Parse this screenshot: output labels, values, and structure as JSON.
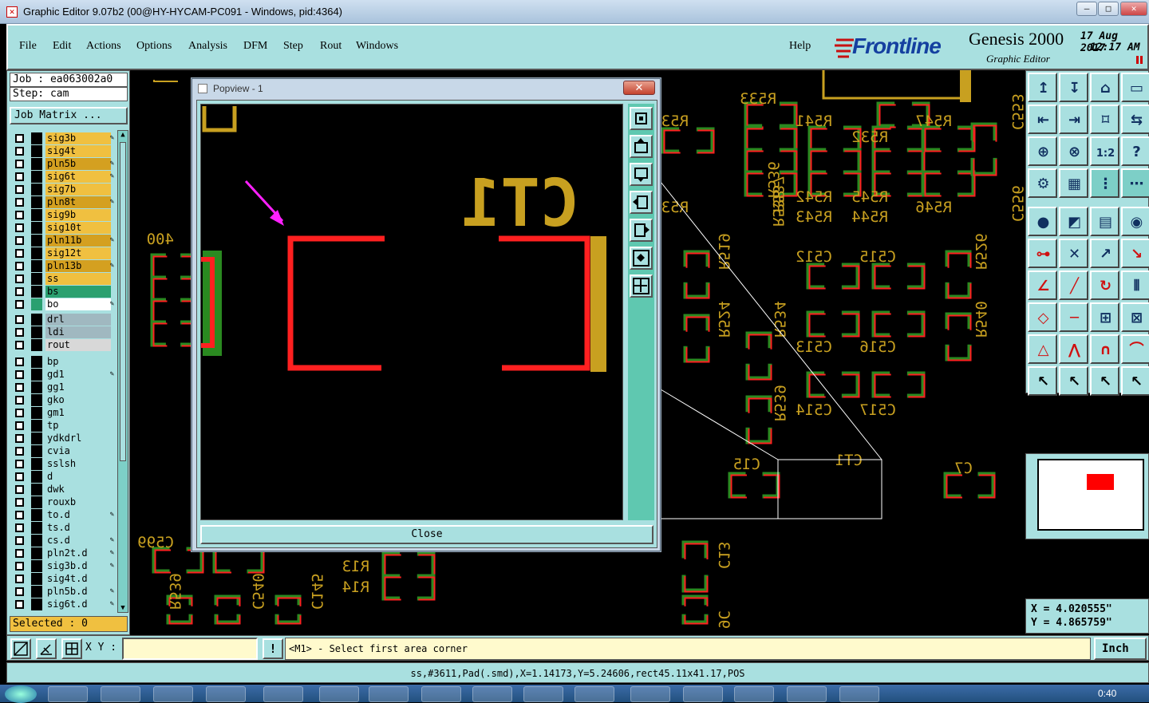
{
  "window": {
    "title": "Graphic Editor 9.07b2 (00@HY-HYCAM-PC091 - Windows, pid:4364)",
    "controls": [
      "—",
      "□",
      "✕"
    ]
  },
  "menu": {
    "items": [
      "File",
      "Edit",
      "Actions",
      "Options",
      "Analysis",
      "DFM",
      "Step",
      "Rout",
      "Windows"
    ],
    "help": "Help"
  },
  "brand": {
    "logo": "Frontline",
    "product": "Genesis 2000",
    "subtitle": "Graphic Editor",
    "date": "17 Aug 2017",
    "time": "12:17 AM"
  },
  "job": {
    "job_label": "Job : ea063002a0",
    "step_label": "Step: cam",
    "matrix_button": "Job Matrix ..."
  },
  "layers": {
    "group1": [
      {
        "name": "sig3b",
        "color": "#f0c040",
        "edit": true
      },
      {
        "name": "sig4t",
        "color": "#f0c040",
        "edit": false
      },
      {
        "name": "pln5b",
        "color": "#d4a020",
        "edit": true
      },
      {
        "name": "sig6t",
        "color": "#f0c040",
        "edit": true
      },
      {
        "name": "sig7b",
        "color": "#f0c040",
        "edit": false
      },
      {
        "name": "pln8t",
        "color": "#d4a020",
        "edit": true
      },
      {
        "name": "sig9b",
        "color": "#f0c040",
        "edit": false
      },
      {
        "name": "sig10t",
        "color": "#f0c040",
        "edit": false
      },
      {
        "name": "pln11b",
        "color": "#d4a020",
        "edit": true
      },
      {
        "name": "sig12t",
        "color": "#f0c040",
        "edit": false
      },
      {
        "name": "pln13b",
        "color": "#d4a020",
        "edit": true
      },
      {
        "name": "ss",
        "color": "#f0c040",
        "edit": false
      },
      {
        "name": "bs",
        "color": "#2aa070",
        "edit": false
      },
      {
        "name": "bo",
        "color": "#ffffff",
        "edit": true
      }
    ],
    "group2": [
      {
        "name": "drl",
        "color": "#a0b8c0",
        "edit": false
      },
      {
        "name": "ldi",
        "color": "#a0b8c0",
        "edit": false
      },
      {
        "name": "rout",
        "color": "#d8d8d8",
        "edit": false
      }
    ],
    "group3": [
      {
        "name": "bp",
        "color": "#a9e0e0",
        "edit": false
      },
      {
        "name": "gd1",
        "color": "#a9e0e0",
        "edit": true
      },
      {
        "name": "gg1",
        "color": "#a9e0e0",
        "edit": false
      },
      {
        "name": "gko",
        "color": "#a9e0e0",
        "edit": false
      },
      {
        "name": "gm1",
        "color": "#a9e0e0",
        "edit": false
      },
      {
        "name": "tp",
        "color": "#a9e0e0",
        "edit": false
      },
      {
        "name": "ydkdrl",
        "color": "#a9e0e0",
        "edit": false
      },
      {
        "name": "cvia",
        "color": "#a9e0e0",
        "edit": false
      },
      {
        "name": "sslsh",
        "color": "#a9e0e0",
        "edit": false
      },
      {
        "name": "d",
        "color": "#a9e0e0",
        "edit": false
      },
      {
        "name": "dwk",
        "color": "#a9e0e0",
        "edit": false
      },
      {
        "name": "rouxb",
        "color": "#a9e0e0",
        "edit": false
      },
      {
        "name": "to.d",
        "color": "#a9e0e0",
        "edit": true
      },
      {
        "name": "ts.d",
        "color": "#a9e0e0",
        "edit": false
      },
      {
        "name": "cs.d",
        "color": "#a9e0e0",
        "edit": true
      },
      {
        "name": "pln2t.d",
        "color": "#a9e0e0",
        "edit": true
      },
      {
        "name": "sig3b.d",
        "color": "#a9e0e0",
        "edit": true
      },
      {
        "name": "sig4t.d",
        "color": "#a9e0e0",
        "edit": false
      },
      {
        "name": "pln5b.d",
        "color": "#a9e0e0",
        "edit": true
      },
      {
        "name": "sig6t.d",
        "color": "#a9e0e0",
        "edit": true
      }
    ],
    "selected_label": "Selected : 0"
  },
  "popview": {
    "title": "Popview - 1",
    "component_label": "CT1",
    "close_label": "Close"
  },
  "pcb": {
    "labels": [
      {
        "t": "R533"
      },
      {
        "t": "R531"
      },
      {
        "t": "R541"
      },
      {
        "t": "R532"
      },
      {
        "t": "R547"
      },
      {
        "t": "C553"
      },
      {
        "t": "R530"
      },
      {
        "t": "R536"
      },
      {
        "t": "R537"
      },
      {
        "t": "R538"
      },
      {
        "t": "R542"
      },
      {
        "t": "R543"
      },
      {
        "t": "R545"
      },
      {
        "t": "R544"
      },
      {
        "t": "R546"
      },
      {
        "t": "C556"
      },
      {
        "t": "R519"
      },
      {
        "t": "C512"
      },
      {
        "t": "C515"
      },
      {
        "t": "R526"
      },
      {
        "t": "R524"
      },
      {
        "t": "R534"
      },
      {
        "t": "C513"
      },
      {
        "t": "C516"
      },
      {
        "t": "R540"
      },
      {
        "t": "R539"
      },
      {
        "t": "C514"
      },
      {
        "t": "C517"
      },
      {
        "t": "C15"
      },
      {
        "t": "CT1"
      },
      {
        "t": "C7"
      },
      {
        "t": "C13"
      },
      {
        "t": "R13"
      },
      {
        "t": "R14"
      },
      {
        "t": "400"
      },
      {
        "t": "C599"
      },
      {
        "t": "R539"
      },
      {
        "t": "C540"
      },
      {
        "t": "C145"
      },
      {
        "t": "9C"
      }
    ]
  },
  "coords": {
    "x": "X = 4.020555\"",
    "y": "Y = 4.865759\""
  },
  "bottom": {
    "xy_label": "X Y :",
    "xy_value": "",
    "prompt": "<M1> - Select first area corner",
    "units": "Inch",
    "status": "ss,#3611,Pad(.smd),X=1.14173,Y=5.24606,rect45.11x41.17,POS"
  },
  "taskbar": {
    "clock": "0:40"
  },
  "colors": {
    "panel": "#a9e0e0",
    "pad_red": "#ff2020",
    "silk": "#c8a020",
    "pad_green": "#2a8a20"
  }
}
